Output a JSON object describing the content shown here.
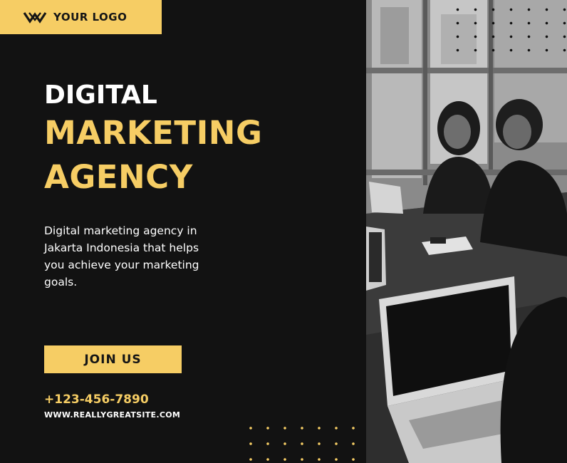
{
  "logo": {
    "text": "YOUR LOGO",
    "icon": "double-chevron-logo-icon"
  },
  "headline": {
    "line1": "DIGITAL",
    "line2": "MARKETING",
    "line3": "AGENCY"
  },
  "description": "Digital marketing agency in Jakarta Indonesia that helps you achieve your marketing goals.",
  "cta": {
    "label": "JOIN US"
  },
  "contact": {
    "phone": "+123-456-7890",
    "website": "WWW.REALLYGREATSITE.COM"
  },
  "colors": {
    "accent": "#f6cd64",
    "background": "#121212",
    "text": "#ffffff"
  }
}
